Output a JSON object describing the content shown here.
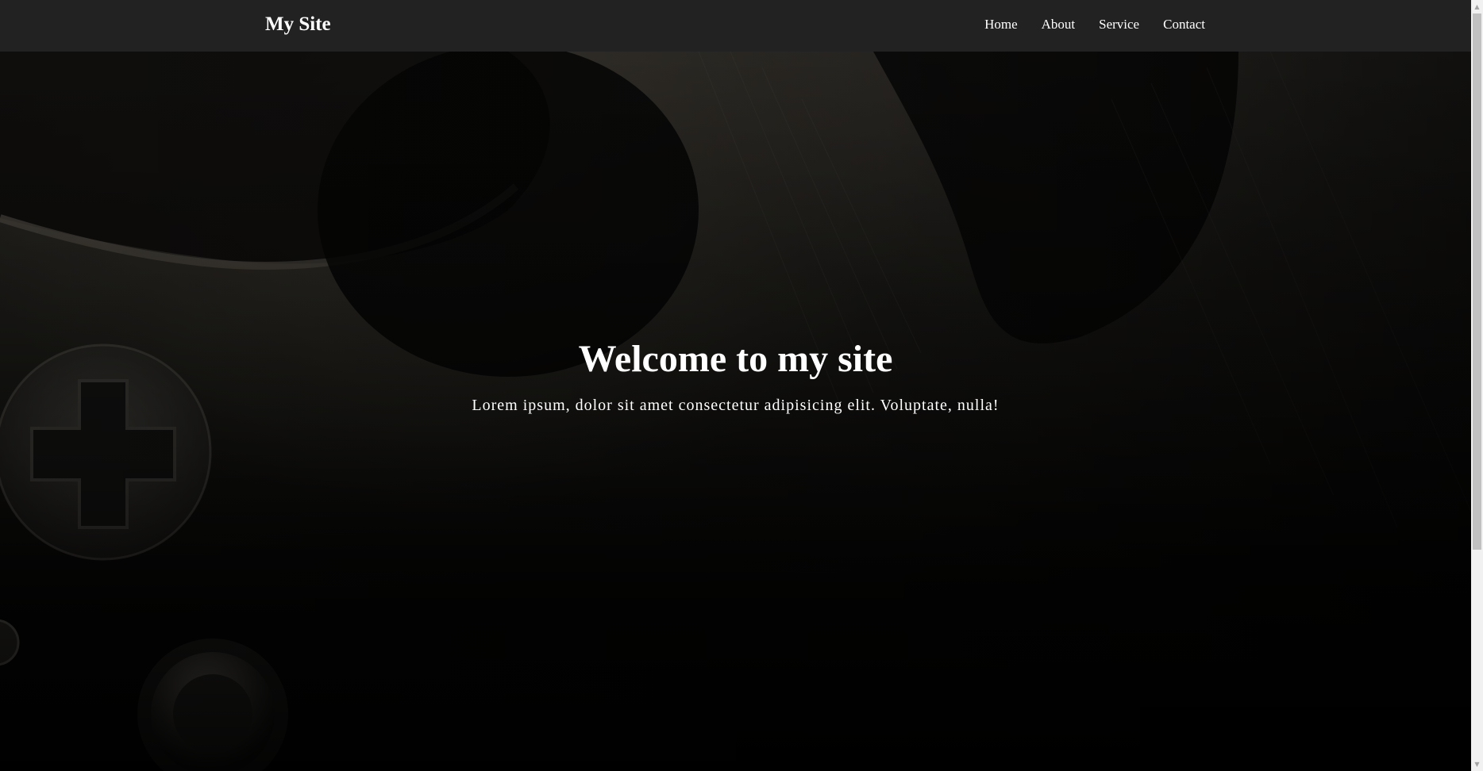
{
  "navbar": {
    "brand": "My Site",
    "links": [
      {
        "label": "Home"
      },
      {
        "label": "About"
      },
      {
        "label": "Service"
      },
      {
        "label": "Contact"
      }
    ]
  },
  "hero": {
    "title": "Welcome to my site",
    "subtitle": "Lorem ipsum, dolor sit amet consectetur adipisicing elit. Voluptate, nulla!",
    "background_image": "game-controller-photo"
  },
  "scrollbar": {
    "up_icon": "scroll-up-arrow-icon",
    "down_icon": "scroll-down-arrow-icon"
  },
  "colors": {
    "navbar_bg": "#222222",
    "text": "#ffffff"
  }
}
